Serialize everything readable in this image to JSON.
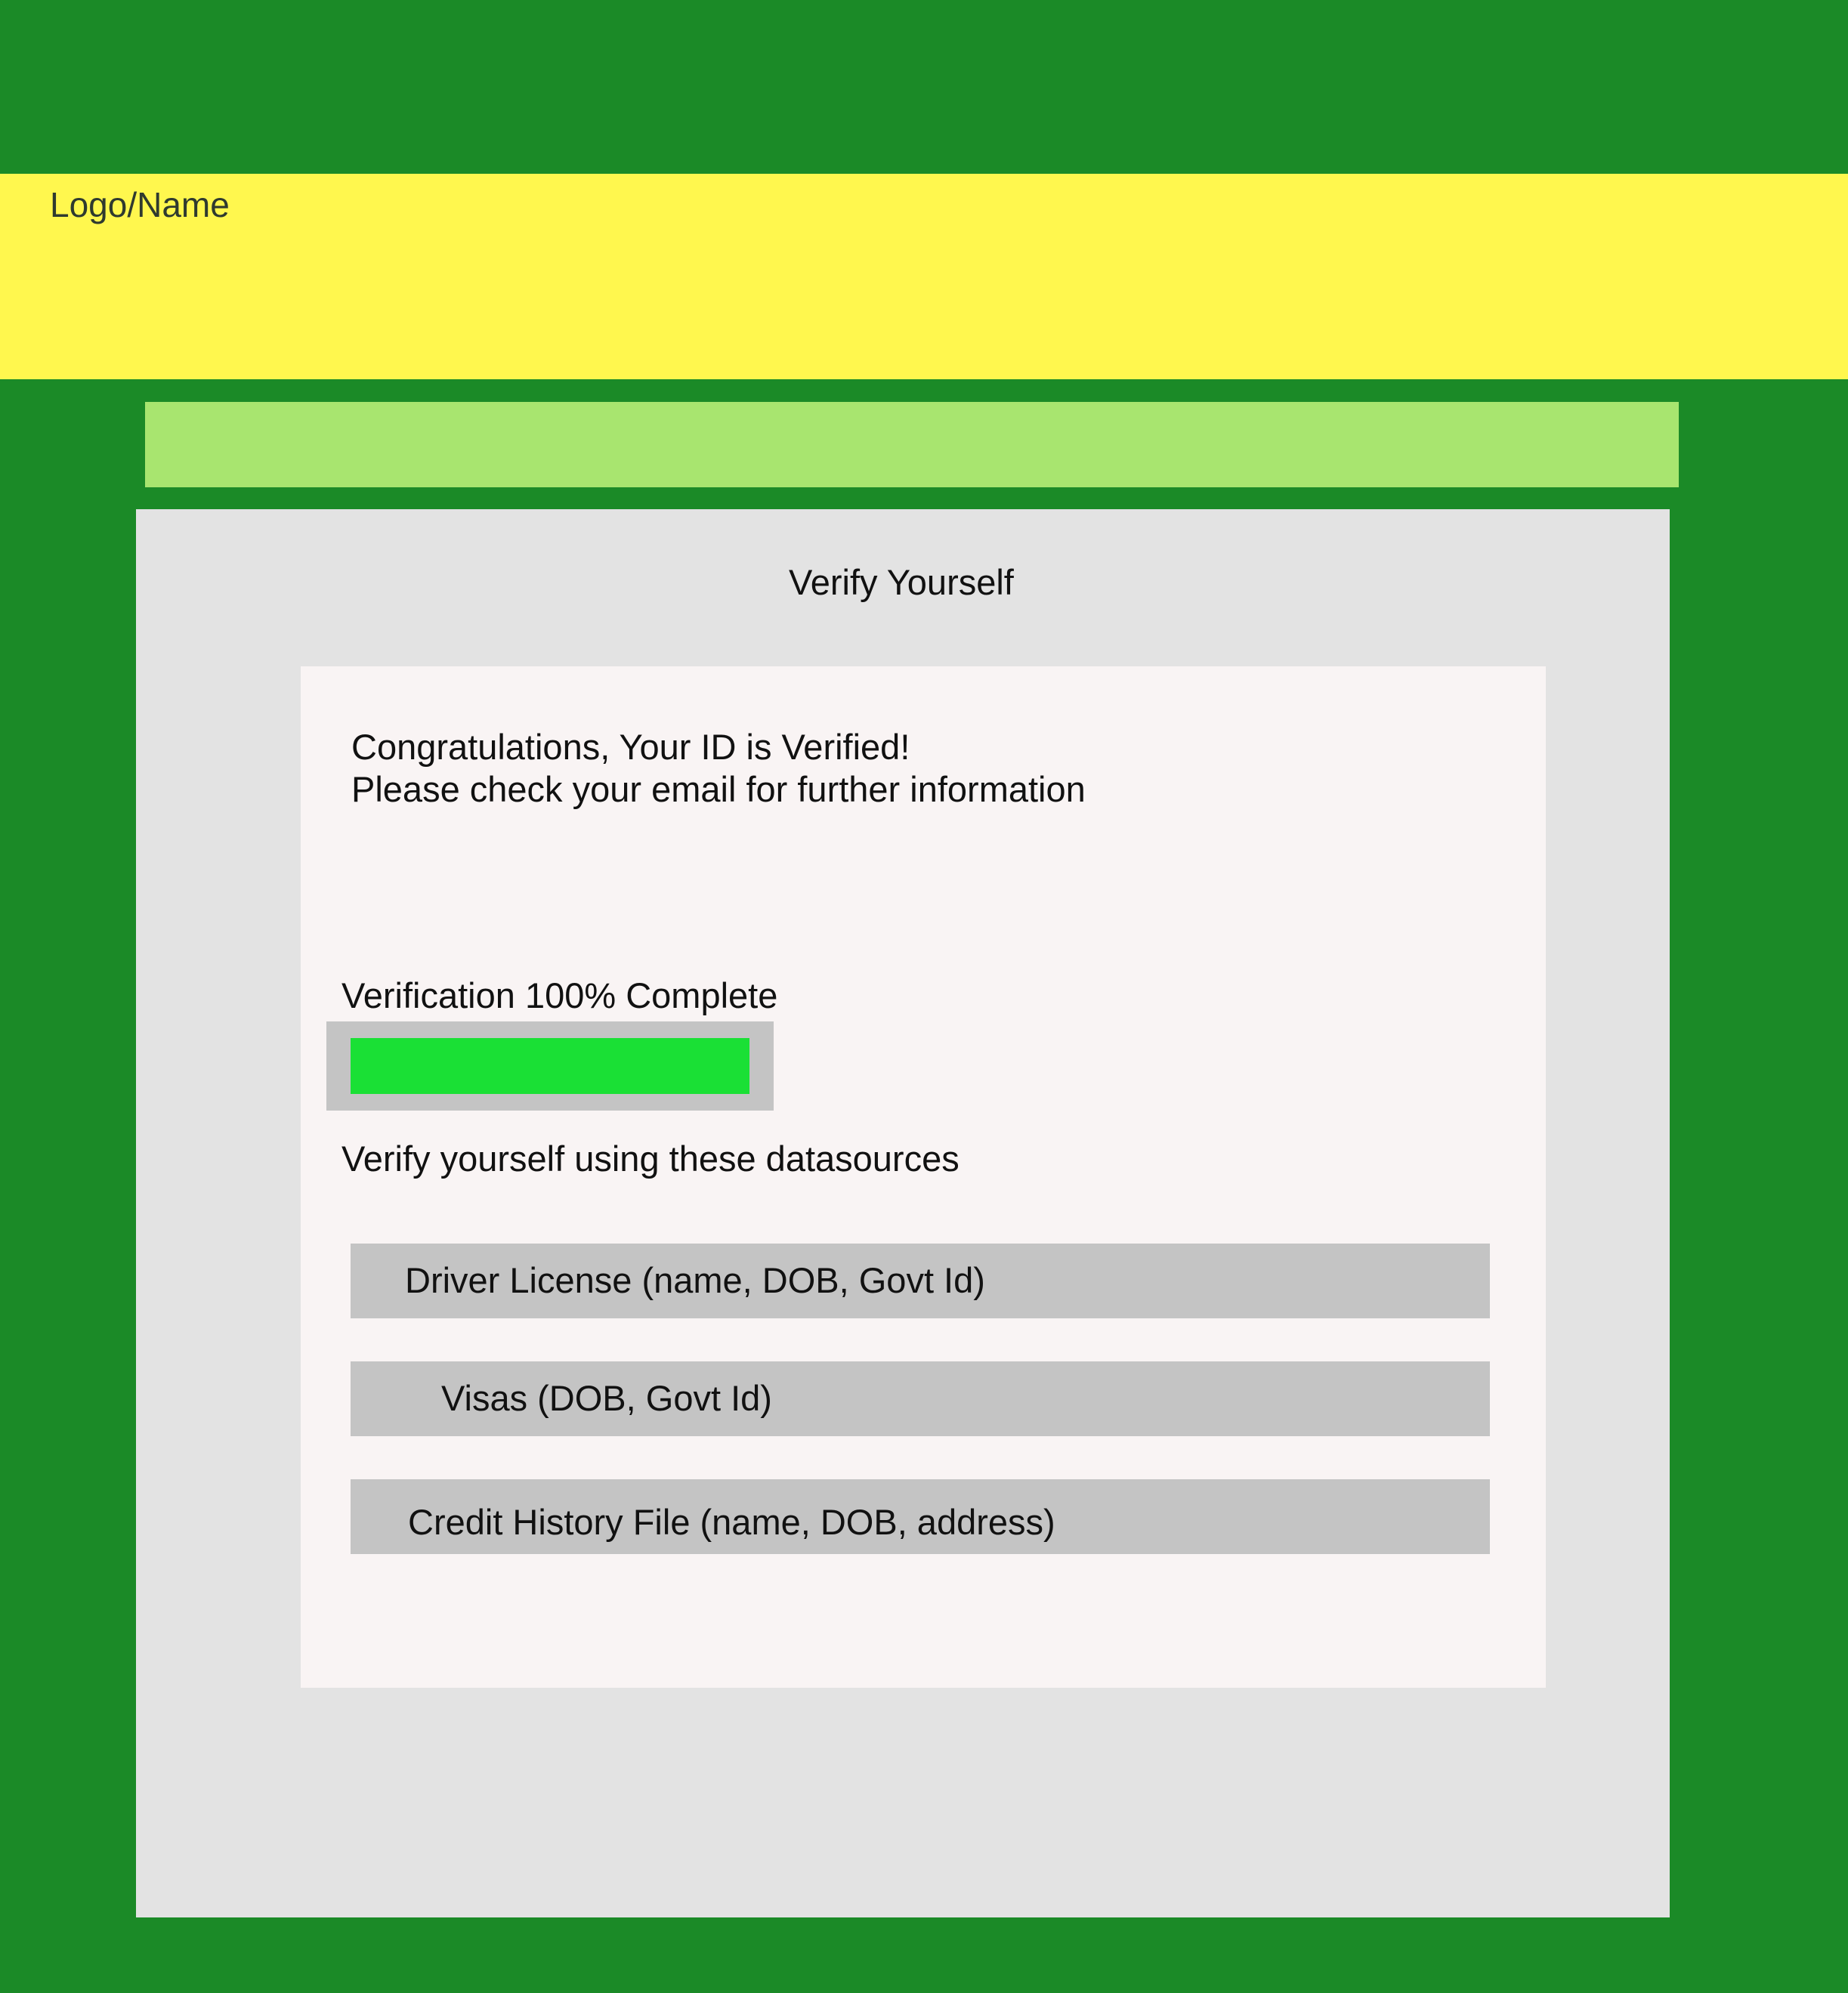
{
  "header": {
    "logo_text": "Logo/Name"
  },
  "panel": {
    "title": "Verify Yourself"
  },
  "status": {
    "message_line_1": "Congratulations, Your ID is Verified!",
    "message_line_2": "Please check your email for further information"
  },
  "progress": {
    "label": "Verification 100% Complete",
    "percent": 100
  },
  "datasources": {
    "heading": "Verify yourself using these datasources",
    "items": [
      {
        "label": "Driver License (name, DOB, Govt Id)"
      },
      {
        "label": "Visas (DOB, Govt Id)"
      },
      {
        "label": "Credit History File (name, DOB, address)"
      }
    ]
  },
  "colors": {
    "page_background": "#1b8a27",
    "header_background": "#fff74e",
    "nav_bar": "#a8e56f",
    "panel_background": "#e3e3e3",
    "card_background": "#f9f4f4",
    "progress_fill": "#1ae035",
    "option_background": "#c4c4c4"
  }
}
